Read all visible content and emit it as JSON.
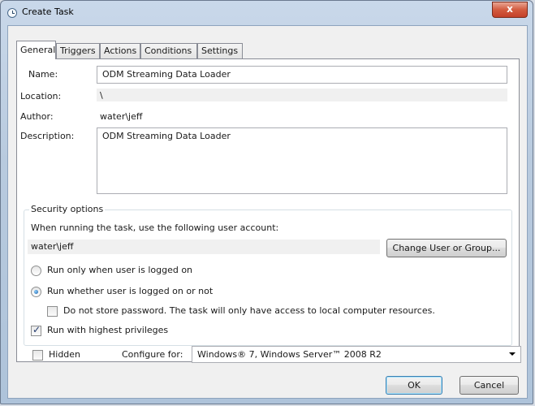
{
  "window": {
    "title": "Create Task",
    "close_label": "x"
  },
  "tabs": [
    {
      "label": "General"
    },
    {
      "label": "Triggers"
    },
    {
      "label": "Actions"
    },
    {
      "label": "Conditions"
    },
    {
      "label": "Settings"
    }
  ],
  "general": {
    "name_label": "Name:",
    "name_value": "ODM Streaming Data Loader",
    "location_label": "Location:",
    "location_value": "\\",
    "author_label": "Author:",
    "author_value": "water\\jeff",
    "description_label": "Description:",
    "description_value": "ODM Streaming Data Loader"
  },
  "security": {
    "legend": "Security options",
    "account_prompt": "When running the task, use the following user account:",
    "account_value": "water\\jeff",
    "change_button": "Change User or Group...",
    "radio_logged_on": "Run only when user is logged on",
    "radio_whether": "Run whether user is logged on or not",
    "no_store_password": "Do not store password.  The task will only have access to local computer resources.",
    "highest_privileges": "Run with highest privileges"
  },
  "bottom": {
    "hidden_label": "Hidden",
    "configure_label": "Configure for:",
    "configure_value": "Windows® 7, Windows Server™ 2008 R2"
  },
  "buttons": {
    "ok": "OK",
    "cancel": "Cancel"
  }
}
